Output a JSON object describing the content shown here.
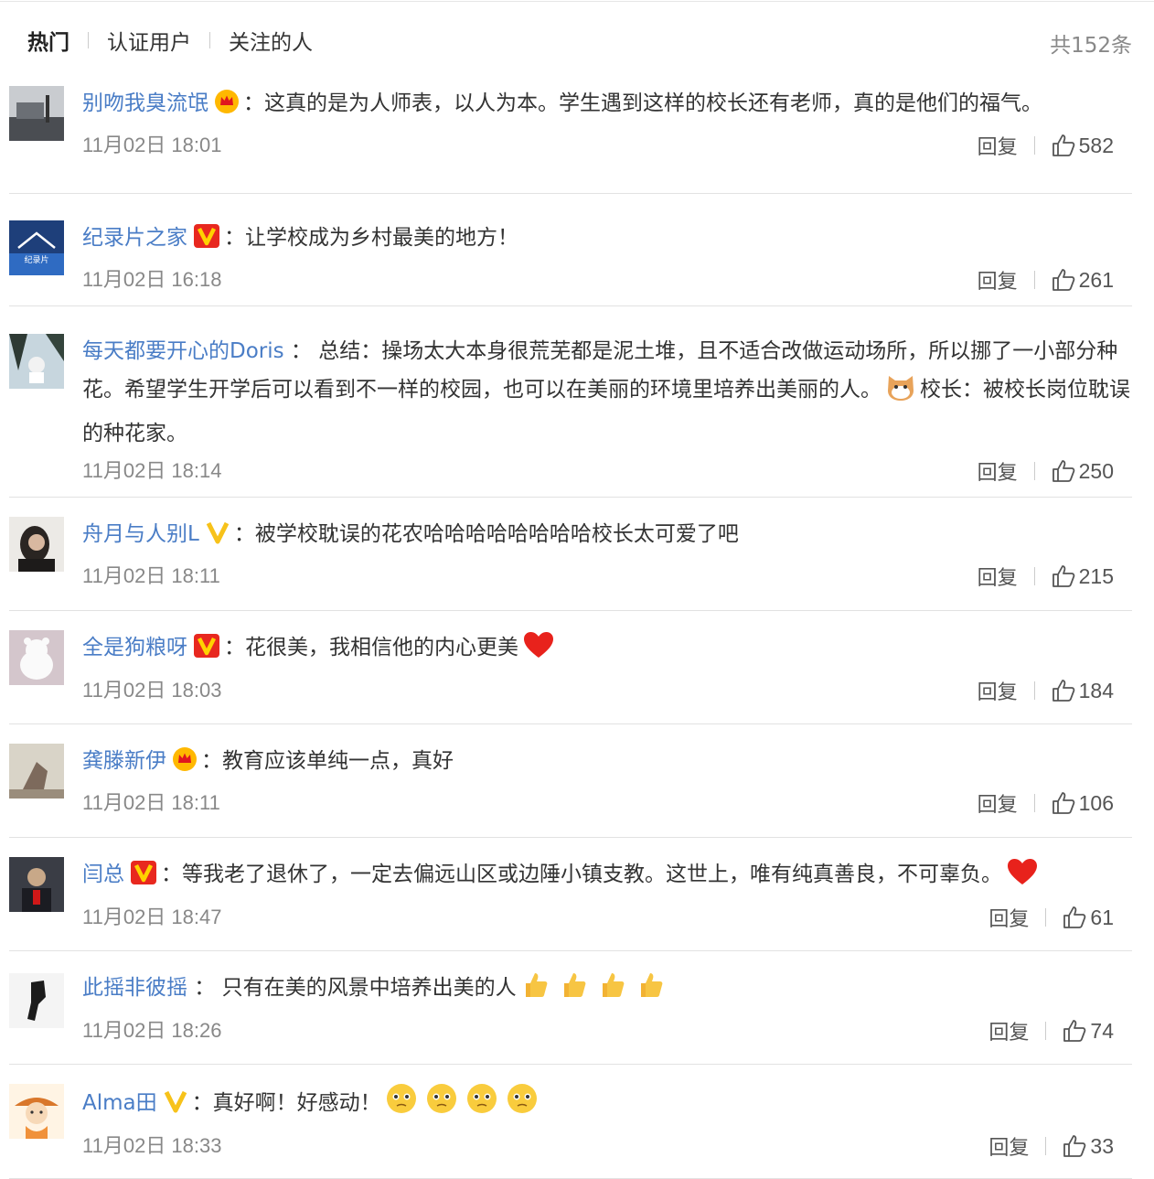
{
  "header": {
    "tabs": [
      {
        "label": "热门"
      },
      {
        "label": "认证用户"
      },
      {
        "label": "关注的人"
      }
    ],
    "count": "共152条"
  },
  "reply_label": "回复",
  "comments": [
    {
      "user": "别吻我臭流氓",
      "badge": "crown",
      "sep": "：",
      "text": "这真的是为人师表，以人为本。学生遇到这样的校长还有老师，真的是他们的福气。",
      "time": "11月02日 18:01",
      "likes": "582"
    },
    {
      "user": "纪录片之家",
      "badge": "v-red",
      "sep": "：",
      "text": "让学校成为乡村最美的地方！",
      "time": "11月02日 16:18",
      "likes": "261"
    },
    {
      "user": "每天都要开心的Doris",
      "badge": "none",
      "sep": " ：",
      "text": "总结：操场太大本身很荒芜都是泥土堆，且不适合改做运动场所，所以挪了一小部分种花。希望学生开学后可以看到不一样的校园，也可以在美丽的环境里培养出美丽的人。",
      "text2": "校长：被校长岗位耽误的种花家。",
      "time": "11月02日 18:14",
      "likes": "250"
    },
    {
      "user": "舟月与人别L",
      "badge": "v-yellow",
      "sep": "：",
      "text": "被学校耽误的花农哈哈哈哈哈哈哈哈校长太可爱了吧",
      "time": "11月02日 18:11",
      "likes": "215"
    },
    {
      "user": "全是狗粮呀",
      "badge": "v-red",
      "sep": "：",
      "text": "花很美，我相信他的内心更美",
      "time": "11月02日 18:03",
      "likes": "184"
    },
    {
      "user": "龚滕新伊",
      "badge": "crown",
      "sep": "：",
      "text": "教育应该单纯一点，真好",
      "time": "11月02日 18:11",
      "likes": "106"
    },
    {
      "user": "闫总",
      "badge": "v-red",
      "sep": "：",
      "text": "等我老了退休了，一定去偏远山区或边陲小镇支教。这世上，唯有纯真善良，不可辜负。",
      "time": "11月02日 18:47",
      "likes": "61"
    },
    {
      "user": "此摇非彼摇",
      "badge": "none",
      "sep": " ：",
      "text": "只有在美的风景中培养出美的人",
      "time": "11月02日 18:26",
      "likes": "74"
    },
    {
      "user": "Alma田",
      "badge": "v-yellow",
      "sep": "：",
      "text": "真好啊！好感动！",
      "time": "11月02日 18:33",
      "likes": "33"
    }
  ],
  "colors": {
    "username": "#4a7dc6",
    "time": "#888888",
    "divider": "#e2e2e2"
  }
}
